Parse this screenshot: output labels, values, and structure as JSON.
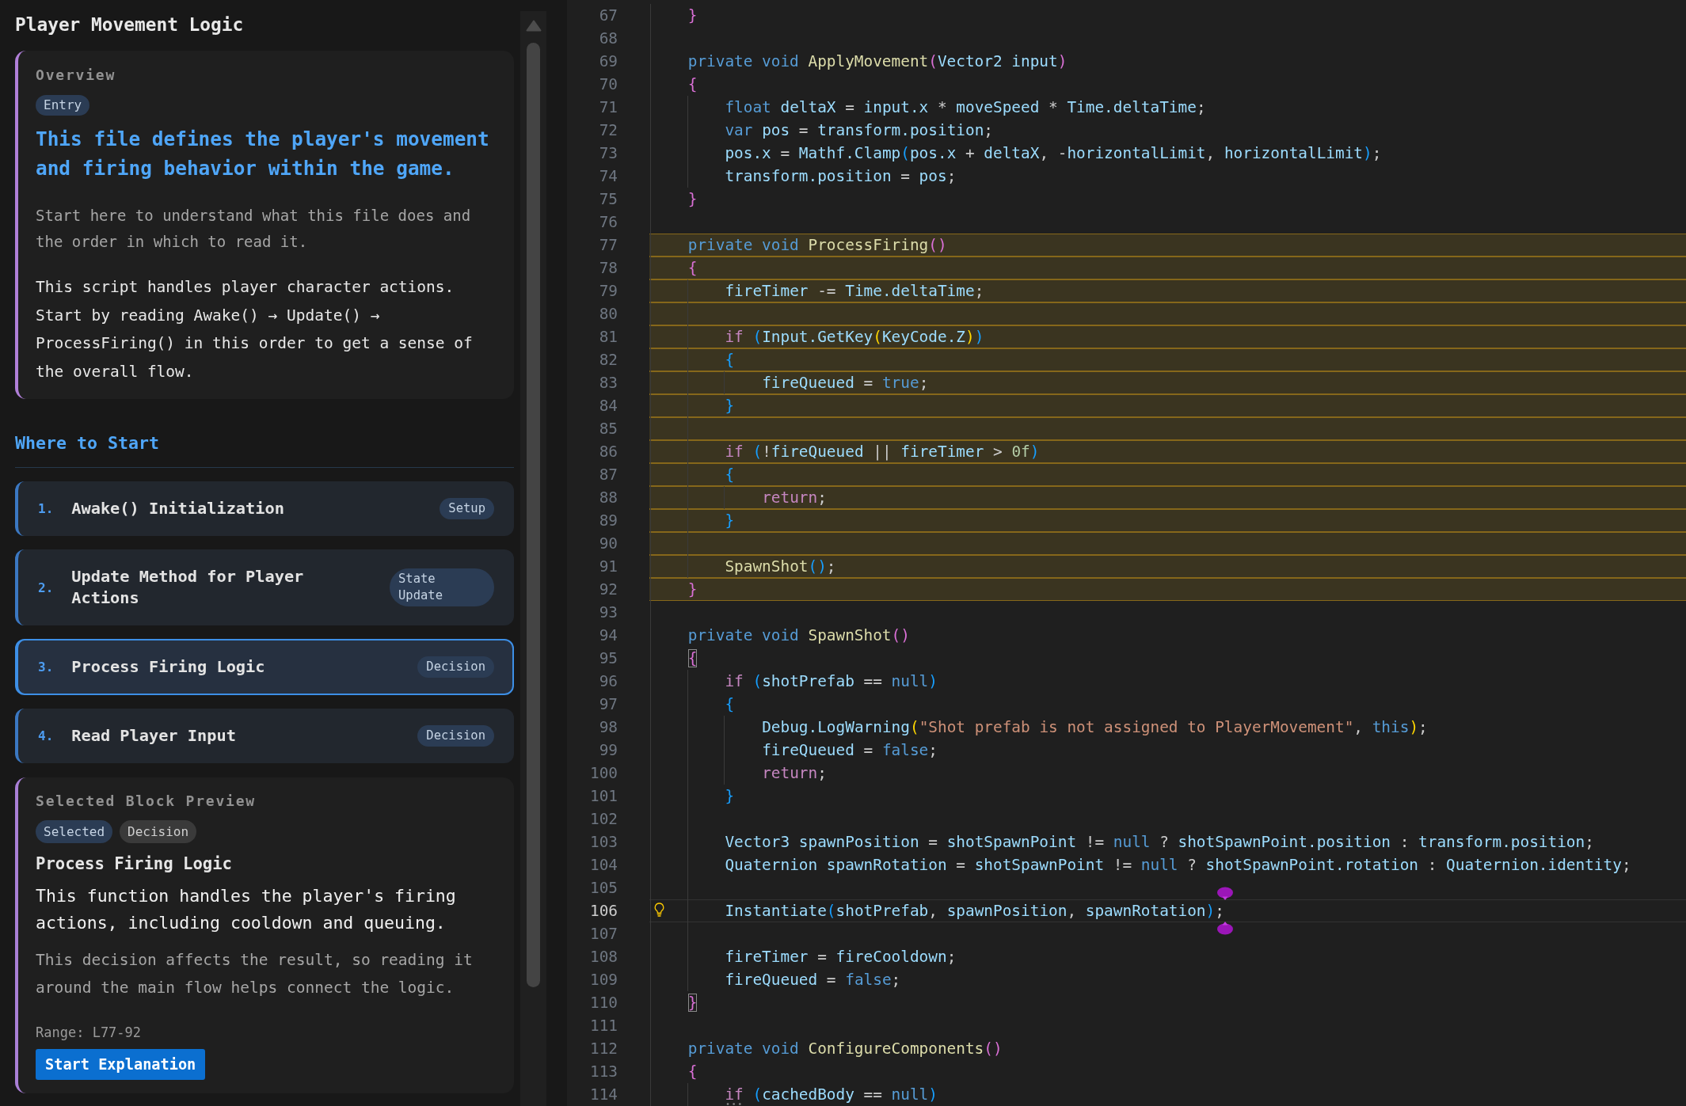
{
  "guide_panel": {
    "title": "Player Movement Logic",
    "overview": {
      "label": "Overview",
      "tag": "Entry",
      "heading": "This file defines the player's movement and firing behavior within the game.",
      "intro": "Start here to understand what this file does and the order in which to read it.",
      "summary": "This script handles player character actions. Start by reading Awake() → Update() → ProcessFiring() in this order to get a sense of the overall flow."
    },
    "section_title": "Where to Start",
    "steps": [
      {
        "number": "1.",
        "title": "Awake() Initialization",
        "tag": "Setup",
        "selected": false
      },
      {
        "number": "2.",
        "title": "Update Method for Player Actions",
        "tag": "State Update",
        "selected": false
      },
      {
        "number": "3.",
        "title": "Process Firing Logic",
        "tag": "Decision",
        "selected": true
      },
      {
        "number": "4.",
        "title": "Read Player Input",
        "tag": "Decision",
        "selected": false
      }
    ],
    "preview": {
      "label": "Selected Block Preview",
      "tags": [
        {
          "text": "Selected",
          "kind": "status"
        },
        {
          "text": "Decision",
          "kind": "category"
        }
      ],
      "title": "Process Firing Logic",
      "summary": "This function handles the player's firing actions, including cooldown and queuing.",
      "note": "This decision affects the result, so reading it around the main flow helps connect the logic.",
      "range": "Range: L77-92",
      "button": "Start Explanation"
    }
  },
  "editor": {
    "lines": [
      {
        "number": "67",
        "highlighted": false,
        "tokens": [
          {
            "kind": "bracket2",
            "text": "    }"
          }
        ]
      },
      {
        "number": "68",
        "highlighted": false
      },
      {
        "number": "69",
        "highlighted": false,
        "tokens": [
          {
            "kind": "keyword",
            "text": "    private void "
          },
          {
            "kind": "function",
            "text": "ApplyMovement"
          },
          {
            "kind": "bracket2",
            "text": "("
          },
          {
            "kind": "name",
            "text": "Vector2 input"
          },
          {
            "kind": "bracket2",
            "text": ")"
          }
        ]
      },
      {
        "number": "70",
        "highlighted": false,
        "tokens": [
          {
            "kind": "bracket2",
            "text": "    {"
          }
        ]
      },
      {
        "number": "71",
        "highlighted": false,
        "tokens": [
          {
            "kind": "keyword",
            "text": "        float "
          },
          {
            "kind": "name",
            "text": "deltaX"
          },
          {
            "kind": "plain",
            "text": " = "
          },
          {
            "kind": "name",
            "text": "input.x"
          },
          {
            "kind": "plain",
            "text": " * "
          },
          {
            "kind": "name",
            "text": "moveSpeed"
          },
          {
            "kind": "plain",
            "text": " * "
          },
          {
            "kind": "name",
            "text": "Time.deltaTime"
          },
          {
            "kind": "plain",
            "text": ";"
          }
        ]
      },
      {
        "number": "72",
        "highlighted": false,
        "tokens": [
          {
            "kind": "keyword",
            "text": "        var "
          },
          {
            "kind": "name",
            "text": "pos"
          },
          {
            "kind": "plain",
            "text": " = "
          },
          {
            "kind": "name",
            "text": "transform.position"
          },
          {
            "kind": "plain",
            "text": ";"
          }
        ]
      },
      {
        "number": "73",
        "highlighted": false,
        "tokens": [
          {
            "kind": "name",
            "text": "        pos.x"
          },
          {
            "kind": "plain",
            "text": " = "
          },
          {
            "kind": "name",
            "text": "Mathf.Clamp"
          },
          {
            "kind": "bracket3",
            "text": "("
          },
          {
            "kind": "name",
            "text": "pos.x"
          },
          {
            "kind": "plain",
            "text": " + "
          },
          {
            "kind": "name",
            "text": "deltaX"
          },
          {
            "kind": "plain",
            "text": ", -"
          },
          {
            "kind": "name",
            "text": "horizontalLimit"
          },
          {
            "kind": "plain",
            "text": ", "
          },
          {
            "kind": "name",
            "text": "horizontalLimit"
          },
          {
            "kind": "bracket3",
            "text": ")"
          },
          {
            "kind": "plain",
            "text": ";"
          }
        ]
      },
      {
        "number": "74",
        "highlighted": false,
        "tokens": [
          {
            "kind": "name",
            "text": "        transform.position"
          },
          {
            "kind": "plain",
            "text": " = "
          },
          {
            "kind": "name",
            "text": "pos"
          },
          {
            "kind": "plain",
            "text": ";"
          }
        ]
      },
      {
        "number": "75",
        "highlighted": false,
        "tokens": [
          {
            "kind": "bracket2",
            "text": "    }"
          }
        ]
      },
      {
        "number": "76",
        "highlighted": false
      },
      {
        "number": "77",
        "highlighted": true,
        "tokens": [
          {
            "kind": "keyword",
            "text": "    private void "
          },
          {
            "kind": "function",
            "text": "ProcessFiring"
          },
          {
            "kind": "bracket2",
            "text": "()"
          }
        ]
      },
      {
        "number": "78",
        "highlighted": true,
        "tokens": [
          {
            "kind": "bracket2",
            "text": "    {"
          }
        ]
      },
      {
        "number": "79",
        "highlighted": true,
        "tokens": [
          {
            "kind": "name",
            "text": "        fireTimer"
          },
          {
            "kind": "plain",
            "text": " -= "
          },
          {
            "kind": "name",
            "text": "Time.deltaTime"
          },
          {
            "kind": "plain",
            "text": ";"
          }
        ]
      },
      {
        "number": "80",
        "highlighted": true
      },
      {
        "number": "81",
        "highlighted": true,
        "tokens": [
          {
            "kind": "control",
            "text": "        if "
          },
          {
            "kind": "bracket3",
            "text": "("
          },
          {
            "kind": "name",
            "text": "Input.GetKey"
          },
          {
            "kind": "bracket1",
            "text": "("
          },
          {
            "kind": "name",
            "text": "KeyCode.Z"
          },
          {
            "kind": "bracket1",
            "text": ")"
          },
          {
            "kind": "bracket3",
            "text": ")"
          }
        ]
      },
      {
        "number": "82",
        "highlighted": true,
        "tokens": [
          {
            "kind": "bracket3",
            "text": "        {"
          }
        ]
      },
      {
        "number": "83",
        "highlighted": true,
        "tokens": [
          {
            "kind": "name",
            "text": "            fireQueued"
          },
          {
            "kind": "plain",
            "text": " = "
          },
          {
            "kind": "keyword",
            "text": "true"
          },
          {
            "kind": "plain",
            "text": ";"
          }
        ]
      },
      {
        "number": "84",
        "highlighted": true,
        "tokens": [
          {
            "kind": "bracket3",
            "text": "        }"
          }
        ]
      },
      {
        "number": "85",
        "highlighted": true
      },
      {
        "number": "86",
        "highlighted": true,
        "tokens": [
          {
            "kind": "control",
            "text": "        if "
          },
          {
            "kind": "bracket3",
            "text": "("
          },
          {
            "kind": "plain",
            "text": "!"
          },
          {
            "kind": "name",
            "text": "fireQueued"
          },
          {
            "kind": "plain",
            "text": " || "
          },
          {
            "kind": "name",
            "text": "fireTimer"
          },
          {
            "kind": "plain",
            "text": " > "
          },
          {
            "kind": "number",
            "text": "0f"
          },
          {
            "kind": "bracket3",
            "text": ")"
          }
        ]
      },
      {
        "number": "87",
        "highlighted": true,
        "tokens": [
          {
            "kind": "bracket3",
            "text": "        {"
          }
        ]
      },
      {
        "number": "88",
        "highlighted": true,
        "tokens": [
          {
            "kind": "control",
            "text": "            return"
          },
          {
            "kind": "plain",
            "text": ";"
          }
        ]
      },
      {
        "number": "89",
        "highlighted": true,
        "tokens": [
          {
            "kind": "bracket3",
            "text": "        }"
          }
        ]
      },
      {
        "number": "90",
        "highlighted": true
      },
      {
        "number": "91",
        "highlighted": true,
        "tokens": [
          {
            "kind": "function",
            "text": "        SpawnShot"
          },
          {
            "kind": "bracket3",
            "text": "()"
          },
          {
            "kind": "plain",
            "text": ";"
          }
        ]
      },
      {
        "number": "92",
        "highlighted": true,
        "tokens": [
          {
            "kind": "bracket2",
            "text": "    }"
          }
        ]
      },
      {
        "number": "93",
        "highlighted": false
      },
      {
        "number": "94",
        "highlighted": false,
        "tokens": [
          {
            "kind": "keyword",
            "text": "    private void "
          },
          {
            "kind": "function",
            "text": "SpawnShot"
          },
          {
            "kind": "bracket2",
            "text": "()"
          }
        ]
      },
      {
        "number": "95",
        "highlighted": false,
        "tokens": [
          {
            "kind": "bracket2",
            "text": "    {",
            "matched": true
          }
        ]
      },
      {
        "number": "96",
        "highlighted": false,
        "tokens": [
          {
            "kind": "control",
            "text": "        if "
          },
          {
            "kind": "bracket3",
            "text": "("
          },
          {
            "kind": "name",
            "text": "shotPrefab"
          },
          {
            "kind": "plain",
            "text": " == "
          },
          {
            "kind": "keyword",
            "text": "null"
          },
          {
            "kind": "bracket3",
            "text": ")"
          }
        ]
      },
      {
        "number": "97",
        "highlighted": false,
        "tokens": [
          {
            "kind": "bracket3",
            "text": "        {"
          }
        ]
      },
      {
        "number": "98",
        "highlighted": false,
        "tokens": [
          {
            "kind": "name",
            "text": "            Debug.LogWarning"
          },
          {
            "kind": "bracket1",
            "text": "("
          },
          {
            "kind": "string",
            "text": "\"Shot prefab is not assigned to PlayerMovement\""
          },
          {
            "kind": "plain",
            "text": ", "
          },
          {
            "kind": "keyword",
            "text": "this"
          },
          {
            "kind": "bracket1",
            "text": ")"
          },
          {
            "kind": "plain",
            "text": ";"
          }
        ]
      },
      {
        "number": "99",
        "highlighted": false,
        "tokens": [
          {
            "kind": "name",
            "text": "            fireQueued"
          },
          {
            "kind": "plain",
            "text": " = "
          },
          {
            "kind": "keyword",
            "text": "false"
          },
          {
            "kind": "plain",
            "text": ";"
          }
        ]
      },
      {
        "number": "100",
        "highlighted": false,
        "tokens": [
          {
            "kind": "control",
            "text": "            return"
          },
          {
            "kind": "plain",
            "text": ";"
          }
        ]
      },
      {
        "number": "101",
        "highlighted": false,
        "tokens": [
          {
            "kind": "bracket3",
            "text": "        }"
          }
        ]
      },
      {
        "number": "102",
        "highlighted": false
      },
      {
        "number": "103",
        "highlighted": false,
        "tokens": [
          {
            "kind": "name",
            "text": "        Vector3 spawnPosition"
          },
          {
            "kind": "plain",
            "text": " = "
          },
          {
            "kind": "name",
            "text": "shotSpawnPoint"
          },
          {
            "kind": "plain",
            "text": " != "
          },
          {
            "kind": "keyword",
            "text": "null"
          },
          {
            "kind": "plain",
            "text": " ? "
          },
          {
            "kind": "name",
            "text": "shotSpawnPoint.position"
          },
          {
            "kind": "plain",
            "text": " : "
          },
          {
            "kind": "name",
            "text": "transform.position"
          },
          {
            "kind": "plain",
            "text": ";"
          }
        ]
      },
      {
        "number": "104",
        "highlighted": false,
        "tokens": [
          {
            "kind": "name",
            "text": "        Quaternion spawnRotation"
          },
          {
            "kind": "plain",
            "text": " = "
          },
          {
            "kind": "name",
            "text": "shotSpawnPoint"
          },
          {
            "kind": "plain",
            "text": " != "
          },
          {
            "kind": "keyword",
            "text": "null"
          },
          {
            "kind": "plain",
            "text": " ? "
          },
          {
            "kind": "name",
            "text": "shotSpawnPoint.rotation"
          },
          {
            "kind": "plain",
            "text": " : "
          },
          {
            "kind": "name",
            "text": "Quaternion.identity"
          },
          {
            "kind": "plain",
            "text": ";"
          }
        ]
      },
      {
        "number": "105",
        "highlighted": false
      },
      {
        "number": "106",
        "highlighted": false,
        "current": true,
        "lightbulb": true,
        "tokens": [
          {
            "kind": "name",
            "text": "        Instantiate"
          },
          {
            "kind": "bracket3",
            "text": "("
          },
          {
            "kind": "name",
            "text": "shotPrefab"
          },
          {
            "kind": "plain",
            "text": ", "
          },
          {
            "kind": "name",
            "text": "spawnPosition"
          },
          {
            "kind": "plain",
            "text": ", "
          },
          {
            "kind": "name",
            "text": "spawnRotation"
          },
          {
            "kind": "bracket3",
            "text": ")"
          },
          {
            "kind": "plain",
            "text": ";"
          }
        ]
      },
      {
        "number": "107",
        "highlighted": false
      },
      {
        "number": "108",
        "highlighted": false,
        "tokens": [
          {
            "kind": "name",
            "text": "        fireTimer"
          },
          {
            "kind": "plain",
            "text": " = "
          },
          {
            "kind": "name",
            "text": "fireCooldown"
          },
          {
            "kind": "plain",
            "text": ";"
          }
        ]
      },
      {
        "number": "109",
        "highlighted": false,
        "tokens": [
          {
            "kind": "name",
            "text": "        fireQueued"
          },
          {
            "kind": "plain",
            "text": " = "
          },
          {
            "kind": "keyword",
            "text": "false"
          },
          {
            "kind": "plain",
            "text": ";"
          }
        ]
      },
      {
        "number": "110",
        "highlighted": false,
        "tokens": [
          {
            "kind": "bracket2",
            "text": "    }",
            "matched": true
          }
        ]
      },
      {
        "number": "111",
        "highlighted": false
      },
      {
        "number": "112",
        "highlighted": false,
        "tokens": [
          {
            "kind": "keyword",
            "text": "    private void "
          },
          {
            "kind": "function",
            "text": "ConfigureComponents"
          },
          {
            "kind": "bracket2",
            "text": "()"
          }
        ]
      },
      {
        "number": "113",
        "highlighted": false,
        "tokens": [
          {
            "kind": "bracket2",
            "text": "    {"
          }
        ]
      },
      {
        "number": "114",
        "highlighted": false,
        "tokens": [
          {
            "kind": "control",
            "text": "        if",
            "hint": true
          },
          {
            "kind": "bracket3",
            "text": " ("
          },
          {
            "kind": "name",
            "text": "cachedBody"
          },
          {
            "kind": "plain",
            "text": " == "
          },
          {
            "kind": "keyword",
            "text": "null"
          },
          {
            "kind": "bracket3",
            "text": ")"
          }
        ]
      }
    ]
  }
}
